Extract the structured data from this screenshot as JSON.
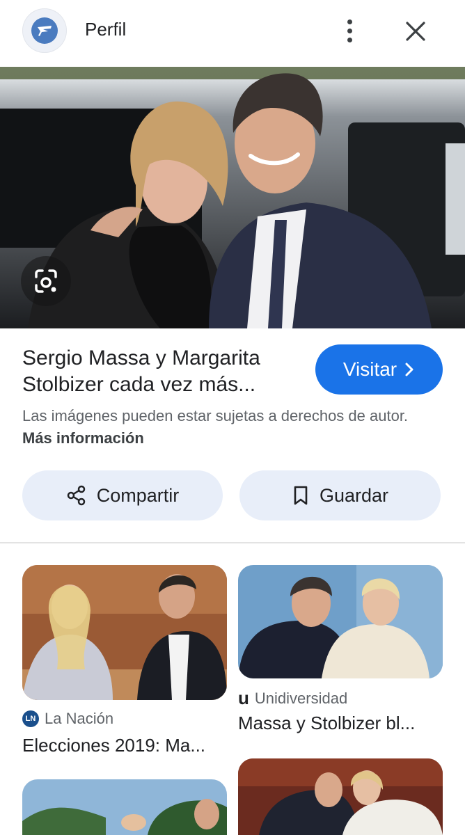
{
  "header": {
    "title": "Perfil",
    "logo_icon": "perfil-logo-icon",
    "more_icon": "more-vert-icon",
    "close_icon": "close-icon"
  },
  "hero": {
    "alt": "Sergio Massa y Margarita Stolbizer cada vez más...",
    "lens_icon": "google-lens-icon"
  },
  "result": {
    "title_line1": "Sergio Massa y Margarita",
    "title_line2": "Stolbizer cada vez más...",
    "visit_label": "Visitar",
    "copyright_text": "Las imágenes pueden estar sujetas a derechos de autor.",
    "more_info_label": "Más información"
  },
  "actions": {
    "share_label": "Compartir",
    "save_label": "Guardar"
  },
  "related": [
    {
      "source": "La Nación",
      "source_badge": "LN",
      "caption": "Elecciones 2019: Ma..."
    },
    {
      "source": "Unidiversidad",
      "source_badge": "u",
      "caption": "Massa y Stolbizer bl..."
    }
  ],
  "colors": {
    "accent": "#1a73e8",
    "chip_bg": "#e8eef9",
    "text_primary": "#202124",
    "text_secondary": "#5f6368"
  }
}
